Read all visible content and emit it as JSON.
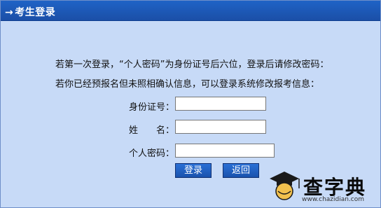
{
  "panel": {
    "title": "考生登录"
  },
  "instructions": {
    "line1": "若第一次登录，“个人密码”为身份证号后六位，登录后请修改密码：",
    "line2": "若你已经预报名但未照相确认信息，可以登录系统修改报考信息："
  },
  "form": {
    "id_label": "身份证号：",
    "name_label": "姓　　名：",
    "password_label": "个人密码：",
    "id_value": "",
    "name_value": "",
    "password_value": ""
  },
  "buttons": {
    "login": "登录",
    "back": "返回"
  },
  "watermark": {
    "text": "查字典",
    "url": "www.chazidian.com"
  }
}
